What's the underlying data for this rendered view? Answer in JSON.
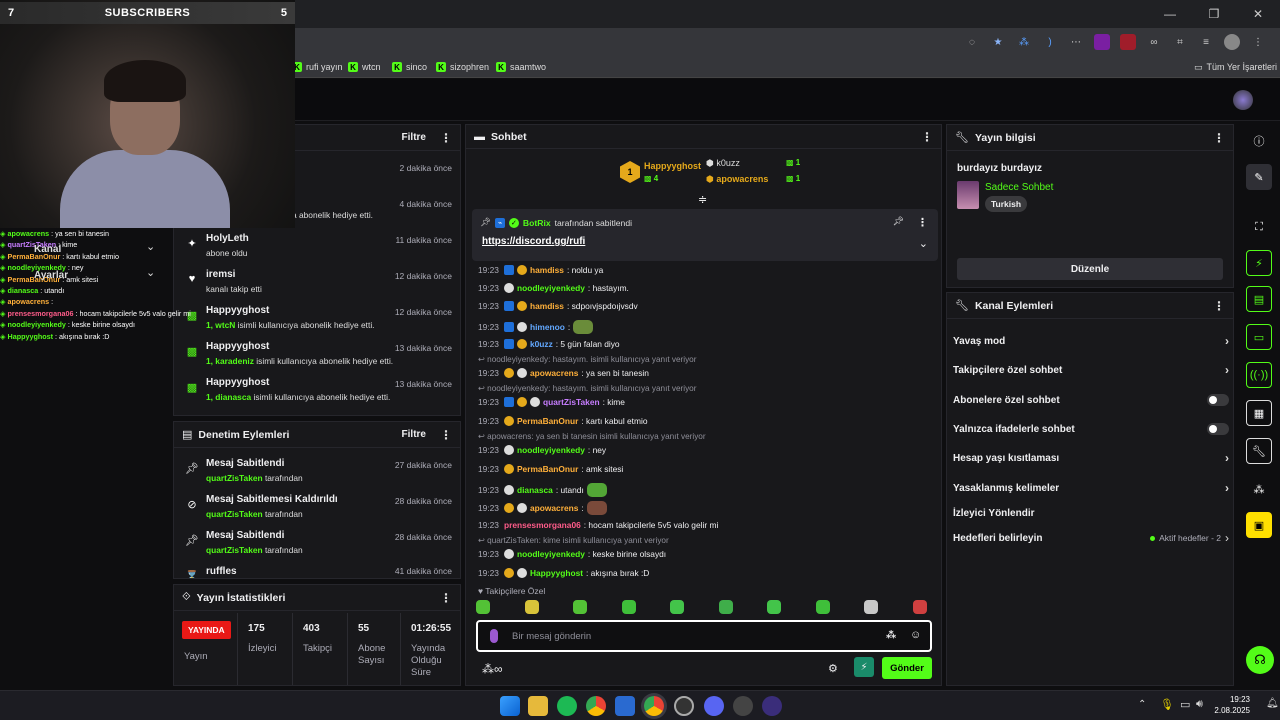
{
  "webcam": {
    "left_count": "7",
    "title": "SUBSCRIBERS",
    "right_count": "5"
  },
  "bookmarks": [
    {
      "label": "rufi yayın"
    },
    {
      "label": "wtcn"
    },
    {
      "label": "sinco"
    },
    {
      "label": "sizophren"
    },
    {
      "label": "saamtwo"
    }
  ],
  "bookmarks_all": "Tüm Yer İşaretleri",
  "overlay_chat": [
    {
      "user": "apowacrens",
      "text": " : ya sen bi tanesin",
      "color": "#53fc18"
    },
    {
      "user": "quartZisTaken",
      "text": " : kime",
      "color": "#c77dff"
    },
    {
      "user": "PermaBanOnur",
      "text": " : kartı kabul etmio",
      "color": "#ffb03a"
    },
    {
      "user": "noodleyiyenkedy",
      "text": " : ney",
      "color": "#53fc18"
    },
    {
      "user": "PermaBanOnur",
      "text": " : amk sitesi",
      "color": "#ffb03a"
    },
    {
      "user": "dianasca",
      "text": " : utandı",
      "color": "#53fc18"
    },
    {
      "user": "apowacrens",
      "text": " : ",
      "color": "#ffb03a"
    },
    {
      "user": "prensesmorgana06",
      "text": " : hocam takipcilerle 5v5 valo gelir mi",
      "color": "#ff5c8a"
    },
    {
      "user": "noodleyiyenkedy",
      "text": " : keske birine olsaydı",
      "color": "#53fc18"
    },
    {
      "user": "Happyyghost",
      "text": " : akışına bırak :D",
      "color": "#53fc18"
    }
  ],
  "overlay_side": {
    "kanal": "Kanal",
    "ayarlar": "Ayarlar"
  },
  "activity": {
    "filter": "Filtre",
    "items": [
      {
        "name": "",
        "sub": "",
        "highlight": "",
        "time": "2 dakika önce",
        "icon": "gift"
      },
      {
        "name": "",
        "sub": "a abonelik hediye etti.",
        "highlight": "",
        "time": "4 dakika önce",
        "icon": "gift"
      },
      {
        "name": "HolyLeth",
        "sub": "abone oldu",
        "highlight": "",
        "time": "11 dakika önce",
        "icon": "star"
      },
      {
        "name": "iremsi",
        "sub": "kanalı takip etti",
        "highlight": "",
        "time": "12 dakika önce",
        "icon": "heart"
      },
      {
        "name": "Happyyghost",
        "sub": " isimli kullanıcıya abonelik hediye etti.",
        "highlight": "1, wtcN",
        "time": "12 dakika önce",
        "icon": "gift"
      },
      {
        "name": "Happyyghost",
        "sub": " isimli kullanıcıya abonelik hediye etti.",
        "highlight": "1, karadeniz",
        "time": "13 dakika önce",
        "icon": "gift"
      },
      {
        "name": "Happyyghost",
        "sub": " isimli kullanıcıya abonelik hediye etti.",
        "highlight": "1, dianasca",
        "time": "13 dakika önce",
        "icon": "gift"
      }
    ]
  },
  "mod_actions": {
    "title": "Denetim Eylemleri",
    "filter": "Filtre",
    "items": [
      {
        "name": "Mesaj Sabitlendi",
        "by": "quartZisTaken",
        "suffix": " tarafından",
        "time": "27 dakika önce"
      },
      {
        "name": "Mesaj Sabitlemesi Kaldırıldı",
        "by": "quartZisTaken",
        "suffix": " tarafından",
        "time": "28 dakika önce"
      },
      {
        "name": "Mesaj Sabitlendi",
        "by": "quartZisTaken",
        "suffix": " tarafından",
        "time": "28 dakika önce"
      },
      {
        "name": "ruffles",
        "by": "",
        "suffix": "",
        "time": "41 dakika önce"
      }
    ]
  },
  "stats": {
    "title": "Yayın İstatistikleri",
    "live": "YAYINDA",
    "live_label": "Yayın",
    "viewers": "175",
    "viewers_label": "İzleyici",
    "followers": "403",
    "followers_label": "Takipçi",
    "subs": "55",
    "subs_label": "Abone Sayısı",
    "duration": "01:26:55",
    "duration_label": "Yayında Olduğu Süre"
  },
  "chat": {
    "title": "Sohbet",
    "gifters": [
      {
        "name": "Happyyghost",
        "rank": "1",
        "count": "4"
      },
      {
        "name": "k0uzz",
        "count": "1"
      },
      {
        "name": "apowacrens",
        "count": "1"
      }
    ],
    "pinned_by": "BotRix",
    "pinned_suffix": "tarafından sabitlendi",
    "pinned_link": "https://discord.gg/rufi",
    "messages": [
      {
        "time": "19:23",
        "user": "hamdiss",
        "text": ": noldu ya",
        "color": "#ffb03a"
      },
      {
        "time": "19:23",
        "user": "noodleyiyenkedy",
        "text": ": hastayım.",
        "color": "#53fc18"
      },
      {
        "time": "19:23",
        "user": "hamdiss",
        "text": ": sdpoıvjspdoıjvsdv",
        "color": "#ffb03a"
      },
      {
        "time": "19:23",
        "user": "himenoo",
        "text": ":",
        "color": "#62a8ff"
      },
      {
        "time": "19:23",
        "user": "k0uzz",
        "text": ": 5 gün falan diyo",
        "color": "#62a8ff"
      },
      {
        "time": "19:23",
        "user": "apowacrens",
        "text": ": ya sen bi tanesin",
        "color": "#ffb03a"
      },
      {
        "time": "19:23",
        "user": "quartZisTaken",
        "text": ": kime",
        "color": "#c77dff"
      },
      {
        "time": "19:23",
        "user": "PermaBanOnur",
        "text": ": kartı kabul etmio",
        "color": "#ffb03a"
      },
      {
        "time": "19:23",
        "user": "noodleyiyenkedy",
        "text": ": ney",
        "color": "#53fc18"
      },
      {
        "time": "19:23",
        "user": "PermaBanOnur",
        "text": ": amk sitesi",
        "color": "#ffb03a"
      },
      {
        "time": "19:23",
        "user": "dianasca",
        "text": ": utandı",
        "color": "#53fc18"
      },
      {
        "time": "19:23",
        "user": "apowacrens",
        "text": ":",
        "color": "#ffb03a"
      },
      {
        "time": "19:23",
        "user": "prensesmorgana06",
        "text": ": hocam takipcilerle 5v5 valo gelir mi",
        "color": "#ff5c8a"
      },
      {
        "time": "19:23",
        "user": "noodleyiyenkedy",
        "text": ": keske birine olsaydı",
        "color": "#53fc18"
      },
      {
        "time": "19:23",
        "user": "Happyyghost",
        "text": ": akışına bırak :D",
        "color": "#53fc18"
      }
    ],
    "replies": [
      "noodleyiyenkedy: hastayım. isimli kullanıcıya yanıt veriyor",
      "noodleyiyenkedy: hastayım. isimli kullanıcıya yanıt veriyor",
      "apowacrens: ya sen bi tanesin isimli kullanıcıya yanıt veriyor",
      "quartZisTaken: kime isimli kullanıcıya yanıt veriyor"
    ],
    "followers_only": "Takipçilere Özel",
    "placeholder": "Bir mesaj gönderin",
    "send": "Gönder"
  },
  "stream_info": {
    "title": "Yayın bilgisi",
    "stream_title": "burdayız burdayız",
    "category": "Sadece Sohbet",
    "tag": "Turkish",
    "edit": "Düzenle"
  },
  "channel_actions": {
    "title": "Kanal Eylemleri",
    "slow": "Yavaş mod",
    "followers": "Takipçilere özel sohbet",
    "subs": "Abonelere özel sohbet",
    "emotes": "Yalnızca ifadelerle sohbet",
    "age": "Hesap yaşı kısıtlaması",
    "banned": "Yasaklanmış kelimeler",
    "raid": "İzleyici Yönlendir",
    "goals": "Hedefleri belirleyin",
    "goals_status": "Aktif hedefler - 2"
  },
  "clock": {
    "time": "19:23",
    "date": "2.08.2025"
  },
  "colors": {
    "accent": "#53fc18",
    "live": "#e91916",
    "panel": "#18181b"
  }
}
